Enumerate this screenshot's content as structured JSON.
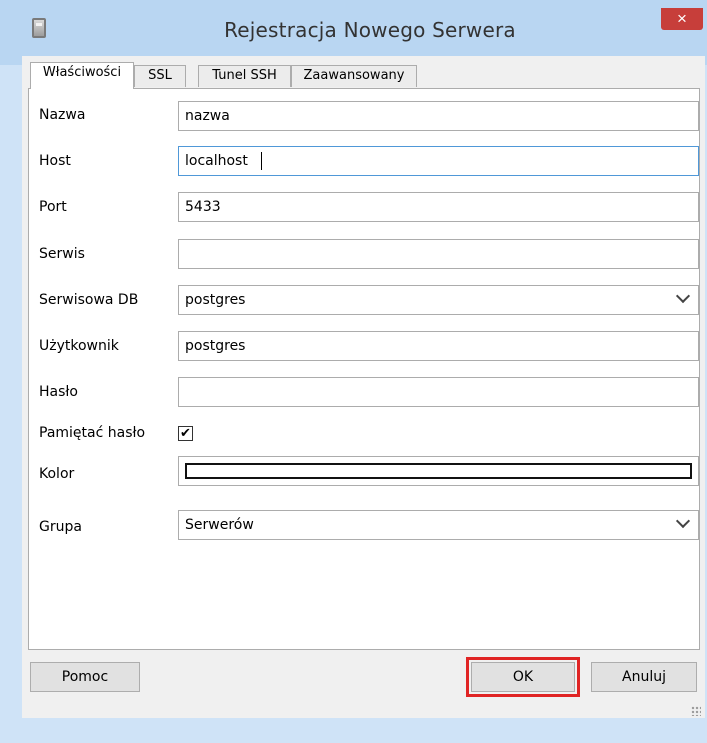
{
  "window": {
    "title": "Rejestracja Nowego Serwera",
    "close_label": "×"
  },
  "tabs": [
    {
      "label": "Właściwości",
      "active": true
    },
    {
      "label": "SSL",
      "active": false
    },
    {
      "label": "Tunel SSH",
      "active": false
    },
    {
      "label": "Zaawansowany",
      "active": false
    }
  ],
  "form": {
    "nazwa": {
      "label": "Nazwa",
      "value": "nazwa"
    },
    "host": {
      "label": "Host",
      "value": "localhost"
    },
    "port": {
      "label": "Port",
      "value": "5433"
    },
    "serwis": {
      "label": "Serwis",
      "value": ""
    },
    "serwisowa_db": {
      "label": "Serwisowa DB",
      "value": "postgres"
    },
    "uzytkownik": {
      "label": "Użytkownik",
      "value": "postgres"
    },
    "haslo": {
      "label": "Hasło",
      "value": ""
    },
    "pamietac_haslo": {
      "label": "Pamiętać hasło",
      "checked": true,
      "mark": "✔"
    },
    "kolor": {
      "label": "Kolor",
      "value": "#ffffff"
    },
    "grupa": {
      "label": "Grupa",
      "value": "Serwerów"
    }
  },
  "buttons": {
    "help": "Pomoc",
    "ok": "OK",
    "cancel": "Anuluj"
  },
  "colors": {
    "titlebar": "#b9d6f2",
    "close": "#c73e3a",
    "focus_border": "#4f98d8",
    "highlight": "#e02424"
  }
}
